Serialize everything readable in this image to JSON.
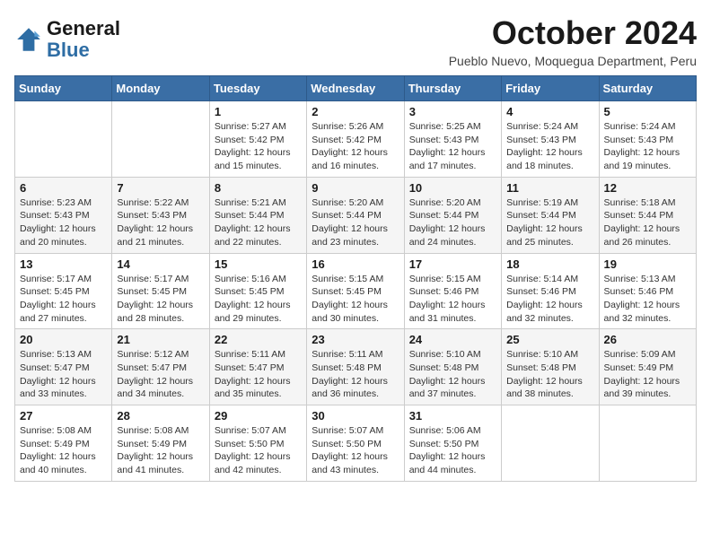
{
  "header": {
    "logo_general": "General",
    "logo_blue": "Blue",
    "month_title": "October 2024",
    "location": "Pueblo Nuevo, Moquegua Department, Peru"
  },
  "days_of_week": [
    "Sunday",
    "Monday",
    "Tuesday",
    "Wednesday",
    "Thursday",
    "Friday",
    "Saturday"
  ],
  "weeks": [
    [
      {
        "day": "",
        "info": ""
      },
      {
        "day": "",
        "info": ""
      },
      {
        "day": "1",
        "info": "Sunrise: 5:27 AM\nSunset: 5:42 PM\nDaylight: 12 hours and 15 minutes."
      },
      {
        "day": "2",
        "info": "Sunrise: 5:26 AM\nSunset: 5:42 PM\nDaylight: 12 hours and 16 minutes."
      },
      {
        "day": "3",
        "info": "Sunrise: 5:25 AM\nSunset: 5:43 PM\nDaylight: 12 hours and 17 minutes."
      },
      {
        "day": "4",
        "info": "Sunrise: 5:24 AM\nSunset: 5:43 PM\nDaylight: 12 hours and 18 minutes."
      },
      {
        "day": "5",
        "info": "Sunrise: 5:24 AM\nSunset: 5:43 PM\nDaylight: 12 hours and 19 minutes."
      }
    ],
    [
      {
        "day": "6",
        "info": "Sunrise: 5:23 AM\nSunset: 5:43 PM\nDaylight: 12 hours and 20 minutes."
      },
      {
        "day": "7",
        "info": "Sunrise: 5:22 AM\nSunset: 5:43 PM\nDaylight: 12 hours and 21 minutes."
      },
      {
        "day": "8",
        "info": "Sunrise: 5:21 AM\nSunset: 5:44 PM\nDaylight: 12 hours and 22 minutes."
      },
      {
        "day": "9",
        "info": "Sunrise: 5:20 AM\nSunset: 5:44 PM\nDaylight: 12 hours and 23 minutes."
      },
      {
        "day": "10",
        "info": "Sunrise: 5:20 AM\nSunset: 5:44 PM\nDaylight: 12 hours and 24 minutes."
      },
      {
        "day": "11",
        "info": "Sunrise: 5:19 AM\nSunset: 5:44 PM\nDaylight: 12 hours and 25 minutes."
      },
      {
        "day": "12",
        "info": "Sunrise: 5:18 AM\nSunset: 5:44 PM\nDaylight: 12 hours and 26 minutes."
      }
    ],
    [
      {
        "day": "13",
        "info": "Sunrise: 5:17 AM\nSunset: 5:45 PM\nDaylight: 12 hours and 27 minutes."
      },
      {
        "day": "14",
        "info": "Sunrise: 5:17 AM\nSunset: 5:45 PM\nDaylight: 12 hours and 28 minutes."
      },
      {
        "day": "15",
        "info": "Sunrise: 5:16 AM\nSunset: 5:45 PM\nDaylight: 12 hours and 29 minutes."
      },
      {
        "day": "16",
        "info": "Sunrise: 5:15 AM\nSunset: 5:45 PM\nDaylight: 12 hours and 30 minutes."
      },
      {
        "day": "17",
        "info": "Sunrise: 5:15 AM\nSunset: 5:46 PM\nDaylight: 12 hours and 31 minutes."
      },
      {
        "day": "18",
        "info": "Sunrise: 5:14 AM\nSunset: 5:46 PM\nDaylight: 12 hours and 32 minutes."
      },
      {
        "day": "19",
        "info": "Sunrise: 5:13 AM\nSunset: 5:46 PM\nDaylight: 12 hours and 32 minutes."
      }
    ],
    [
      {
        "day": "20",
        "info": "Sunrise: 5:13 AM\nSunset: 5:47 PM\nDaylight: 12 hours and 33 minutes."
      },
      {
        "day": "21",
        "info": "Sunrise: 5:12 AM\nSunset: 5:47 PM\nDaylight: 12 hours and 34 minutes."
      },
      {
        "day": "22",
        "info": "Sunrise: 5:11 AM\nSunset: 5:47 PM\nDaylight: 12 hours and 35 minutes."
      },
      {
        "day": "23",
        "info": "Sunrise: 5:11 AM\nSunset: 5:48 PM\nDaylight: 12 hours and 36 minutes."
      },
      {
        "day": "24",
        "info": "Sunrise: 5:10 AM\nSunset: 5:48 PM\nDaylight: 12 hours and 37 minutes."
      },
      {
        "day": "25",
        "info": "Sunrise: 5:10 AM\nSunset: 5:48 PM\nDaylight: 12 hours and 38 minutes."
      },
      {
        "day": "26",
        "info": "Sunrise: 5:09 AM\nSunset: 5:49 PM\nDaylight: 12 hours and 39 minutes."
      }
    ],
    [
      {
        "day": "27",
        "info": "Sunrise: 5:08 AM\nSunset: 5:49 PM\nDaylight: 12 hours and 40 minutes."
      },
      {
        "day": "28",
        "info": "Sunrise: 5:08 AM\nSunset: 5:49 PM\nDaylight: 12 hours and 41 minutes."
      },
      {
        "day": "29",
        "info": "Sunrise: 5:07 AM\nSunset: 5:50 PM\nDaylight: 12 hours and 42 minutes."
      },
      {
        "day": "30",
        "info": "Sunrise: 5:07 AM\nSunset: 5:50 PM\nDaylight: 12 hours and 43 minutes."
      },
      {
        "day": "31",
        "info": "Sunrise: 5:06 AM\nSunset: 5:50 PM\nDaylight: 12 hours and 44 minutes."
      },
      {
        "day": "",
        "info": ""
      },
      {
        "day": "",
        "info": ""
      }
    ]
  ]
}
